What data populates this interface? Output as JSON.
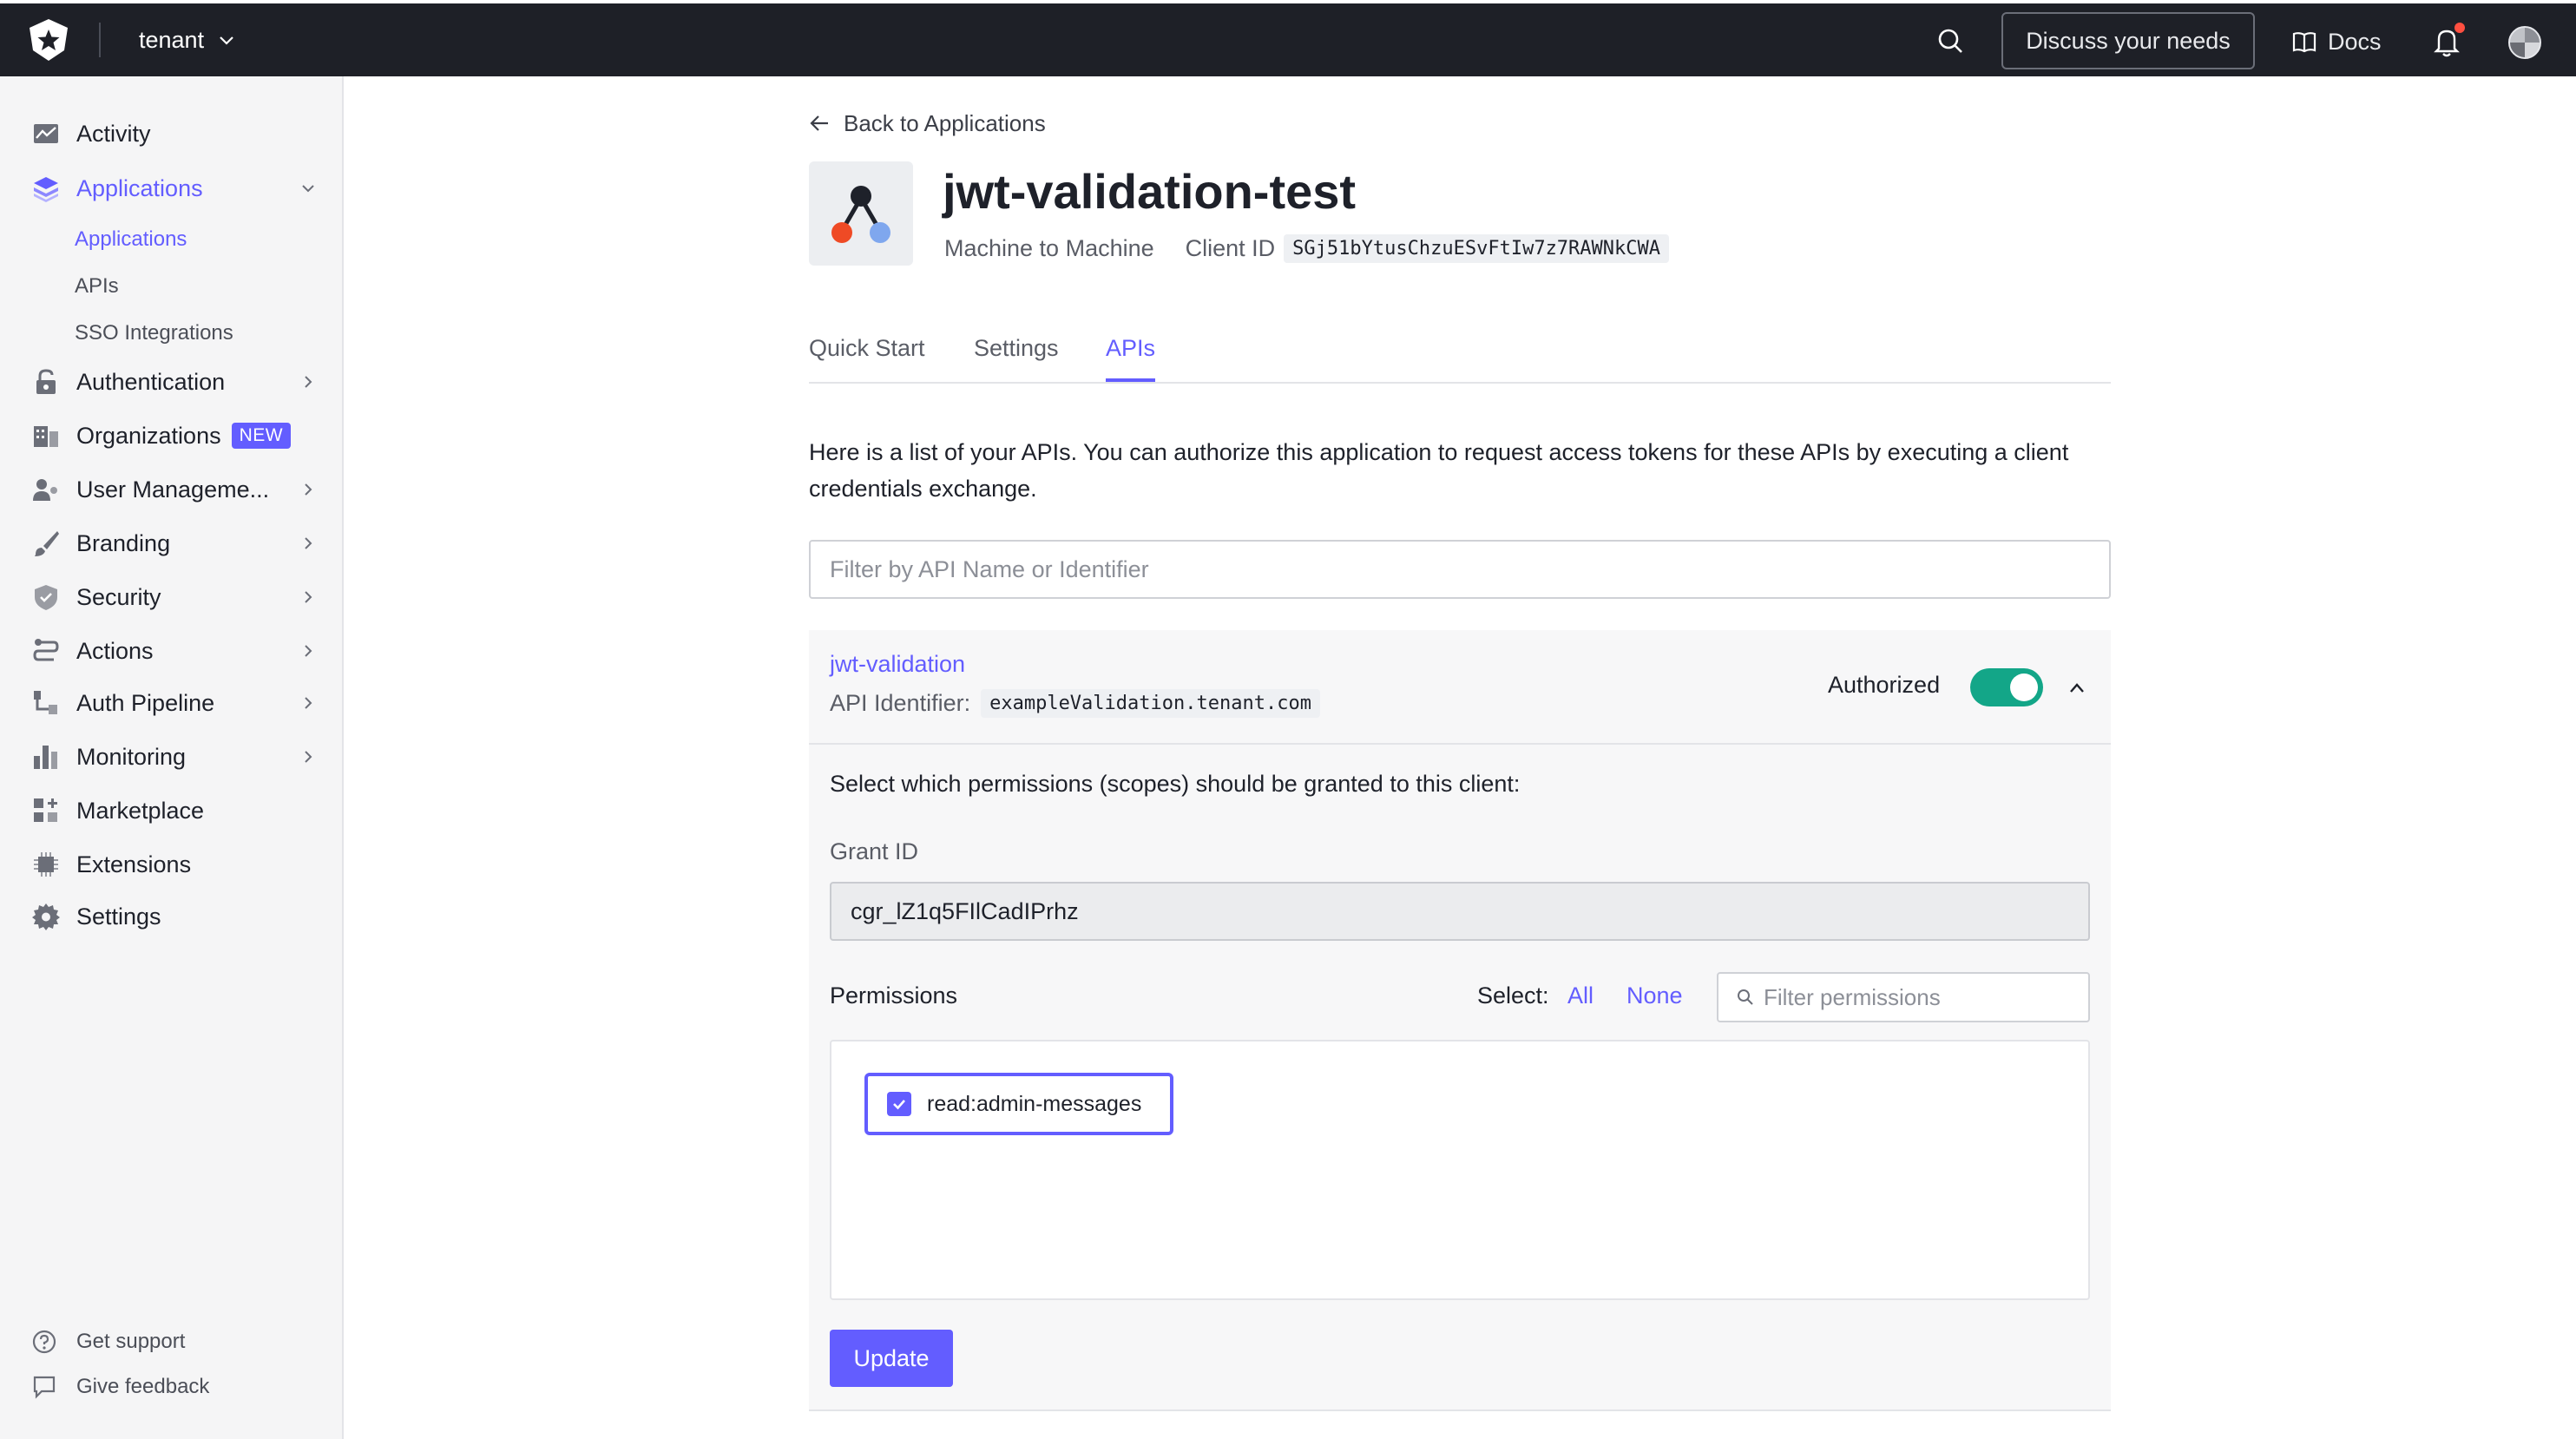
{
  "topbar": {
    "tenant_label": "tenant",
    "discuss_label": "Discuss your needs",
    "docs_label": "Docs"
  },
  "sidebar": {
    "items": [
      {
        "label": "Activity",
        "icon": "activity-icon"
      },
      {
        "label": "Applications",
        "icon": "applications-icon"
      },
      {
        "label": "Authentication",
        "icon": "lock-icon"
      },
      {
        "label": "Organizations",
        "icon": "organizations-icon",
        "badge": "NEW"
      },
      {
        "label": "User Manageme...",
        "icon": "users-icon"
      },
      {
        "label": "Branding",
        "icon": "brush-icon"
      },
      {
        "label": "Security",
        "icon": "shield-icon"
      },
      {
        "label": "Actions",
        "icon": "actions-icon"
      },
      {
        "label": "Auth Pipeline",
        "icon": "pipeline-icon"
      },
      {
        "label": "Monitoring",
        "icon": "bar-chart-icon"
      },
      {
        "label": "Marketplace",
        "icon": "marketplace-icon"
      },
      {
        "label": "Extensions",
        "icon": "chip-icon"
      },
      {
        "label": "Settings",
        "icon": "gear-icon"
      }
    ],
    "sub_items": [
      {
        "label": "Applications"
      },
      {
        "label": "APIs"
      },
      {
        "label": "SSO Integrations"
      }
    ],
    "footer": [
      {
        "label": "Get support",
        "icon": "help-icon"
      },
      {
        "label": "Give feedback",
        "icon": "feedback-icon"
      }
    ]
  },
  "main": {
    "back_label": "Back to Applications",
    "app_name": "jwt-validation-test",
    "app_type": "Machine to Machine",
    "client_id_label": "Client ID",
    "client_id": "SGj51bYtusChzuESvFtIw7z7RAWNkCWA",
    "tabs": [
      {
        "label": "Quick Start"
      },
      {
        "label": "Settings"
      },
      {
        "label": "APIs"
      }
    ],
    "description": "Here is a list of your APIs. You can authorize this application to request access tokens for these APIs by executing a client credentials exchange.",
    "filter_placeholder": "Filter by API Name or Identifier",
    "api": {
      "name": "jwt-validation",
      "identifier_label": "API Identifier:",
      "identifier": "exampleValidation.tenant.com",
      "authorized_label": "Authorized",
      "authorized": true,
      "scopes_text": "Select which permissions (scopes) should be granted to this client:",
      "grant_label": "Grant ID",
      "grant_id": "cgr_lZ1q5FIlCadIPrhz",
      "permissions_label": "Permissions",
      "select_label": "Select:",
      "select_all": "All",
      "select_none": "None",
      "permission_filter_placeholder": "Filter permissions",
      "permissions": [
        {
          "name": "read:admin-messages",
          "checked": true
        }
      ],
      "update_label": "Update"
    }
  },
  "colors": {
    "accent": "#635dff",
    "topbar": "#1e2027",
    "toggle_on": "#13a688"
  }
}
